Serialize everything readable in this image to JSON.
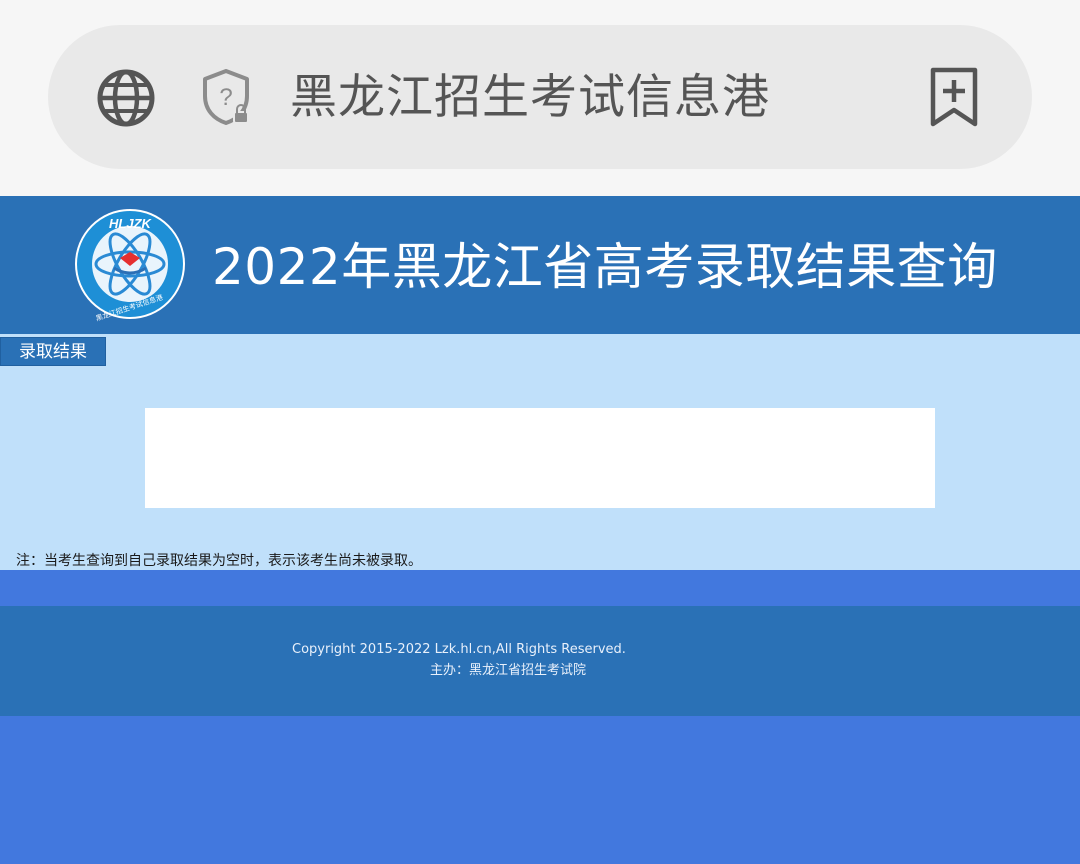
{
  "browser": {
    "address_text": "黑龙江招生考试信息港",
    "icons": [
      "globe-icon",
      "security-shield-icon",
      "add-bookmark-icon"
    ]
  },
  "header": {
    "logo_text": "HLJZK",
    "logo_subtext": "黑龙江招生考试信息港",
    "title": "2022年黑龙江省高考录取结果查询"
  },
  "tabs": {
    "result_label": "录取结果"
  },
  "note": "注：当考生查询到自己录取结果为空时，表示该考生尚未被录取。",
  "footer": {
    "copyright": "Copyright 2015-2022 Lzk.hl.cn,All Rights Reserved.",
    "organizer": "主办：黑龙江省招生考试院"
  },
  "colors": {
    "header_blue": "#2a71b6",
    "content_bg": "#c0e0fa",
    "page_bg": "#4278de",
    "browser_bg": "#f6f6f6"
  }
}
